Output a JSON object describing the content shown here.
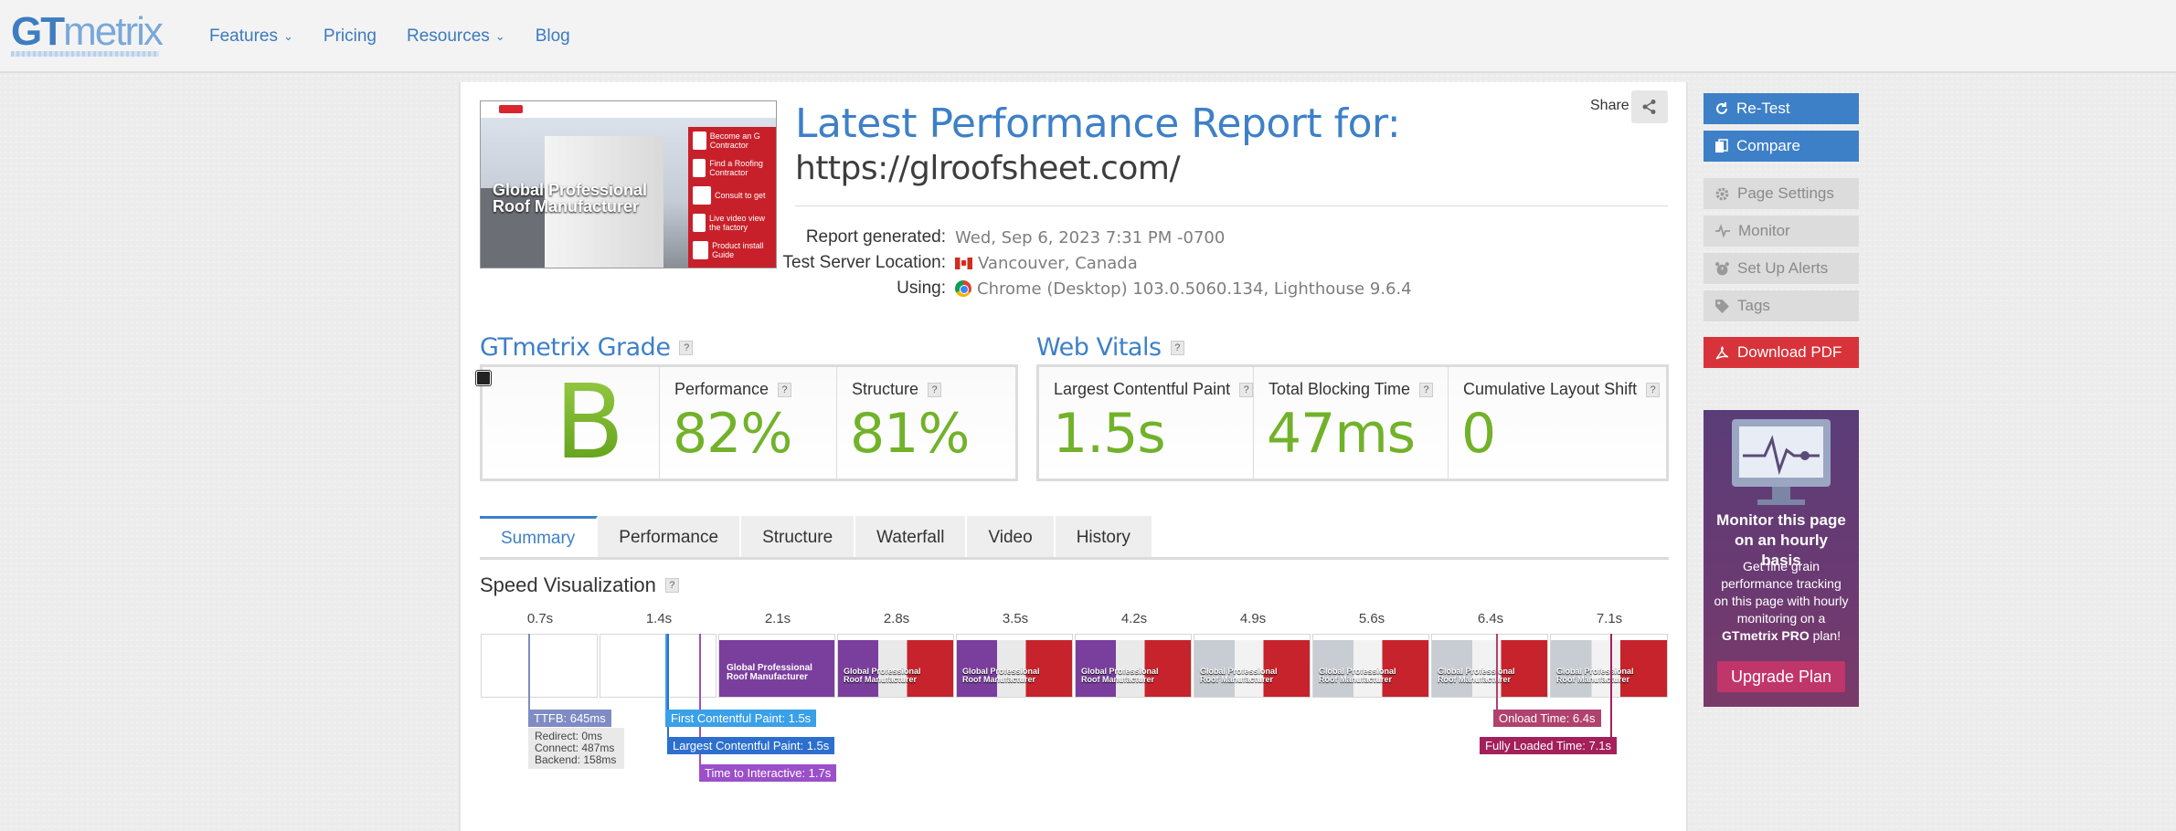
{
  "nav": {
    "logo": {
      "gt": "GT",
      "metrix": "metrix"
    },
    "items": [
      {
        "label": "Features",
        "has_menu": true
      },
      {
        "label": "Pricing",
        "has_menu": false
      },
      {
        "label": "Resources",
        "has_menu": true
      },
      {
        "label": "Blog",
        "has_menu": false
      }
    ]
  },
  "thumbnail": {
    "headline_1": "Global Professional",
    "headline_2": "Roof Manufacturer",
    "panel_items": [
      "Become an G Contractor",
      "Find a Roofing Contractor",
      "Consult to get",
      "Live video view the factory",
      "Product install Guide"
    ]
  },
  "report": {
    "title": "Latest Performance Report for:",
    "url": "https://glroofsheet.com/",
    "share_label": "Share",
    "generated_label": "Report generated:",
    "generated_value": "Wed, Sep 6, 2023 7:31 PM -0700",
    "location_label": "Test Server Location:",
    "location_value": "Vancouver, Canada",
    "using_label": "Using:",
    "using_value": "Chrome (Desktop) 103.0.5060.134, Lighthouse 9.6.4"
  },
  "grade": {
    "title": "GTmetrix Grade",
    "letter": "B",
    "performance_label": "Performance",
    "performance_value": "82%",
    "structure_label": "Structure",
    "structure_value": "81%"
  },
  "vitals": {
    "title": "Web Vitals",
    "lcp_label": "Largest Contentful Paint",
    "lcp_value": "1.5s",
    "tbt_label": "Total Blocking Time",
    "tbt_value": "47ms",
    "cls_label": "Cumulative Layout Shift",
    "cls_value": "0"
  },
  "tabs": [
    "Summary",
    "Performance",
    "Structure",
    "Waterfall",
    "Video",
    "History"
  ],
  "speed": {
    "title": "Speed Visualization",
    "ticks": [
      "0.7s",
      "1.4s",
      "2.1s",
      "2.8s",
      "3.5s",
      "4.2s",
      "4.9s",
      "5.6s",
      "6.4s",
      "7.1s"
    ],
    "frame_text_1": "Global Professional",
    "frame_text_2": "Roof Manufacturer",
    "ttfb": "TTFB: 645ms",
    "redirect": "Redirect: 0ms",
    "connect": "Connect: 487ms",
    "backend": "Backend: 158ms",
    "fcp": "First Contentful Paint: 1.5s",
    "lcp": "Largest Contentful Paint: 1.5s",
    "tti": "Time to Interactive: 1.7s",
    "onload": "Onload Time: 6.4s",
    "fully_loaded": "Fully Loaded Time: 7.1s"
  },
  "sidebar": {
    "retest": "Re-Test",
    "compare": "Compare",
    "page_settings": "Page Settings",
    "monitor": "Monitor",
    "alerts": "Set Up Alerts",
    "tags": "Tags",
    "download": "Download PDF",
    "promo_title": "Monitor this page on an hourly basis",
    "promo_text_1": "Get fine grain performance tracking on this page with hourly monitoring on a",
    "promo_text_bold": "GTmetrix PRO",
    "promo_text_2": "plan!",
    "promo_button": "Upgrade Plan"
  },
  "colors": {
    "brand_blue": "#3e80c8",
    "grade_green": "#72b22a",
    "pdf_red": "#d8333a",
    "promo_purple": "#6b3a72",
    "ttfb": "#7f8cc4",
    "fcp": "#3aa0e8",
    "lcp": "#2d6fcf",
    "tti": "#9b4fc9",
    "onload": "#b0426e",
    "fully_loaded": "#a3205a"
  }
}
